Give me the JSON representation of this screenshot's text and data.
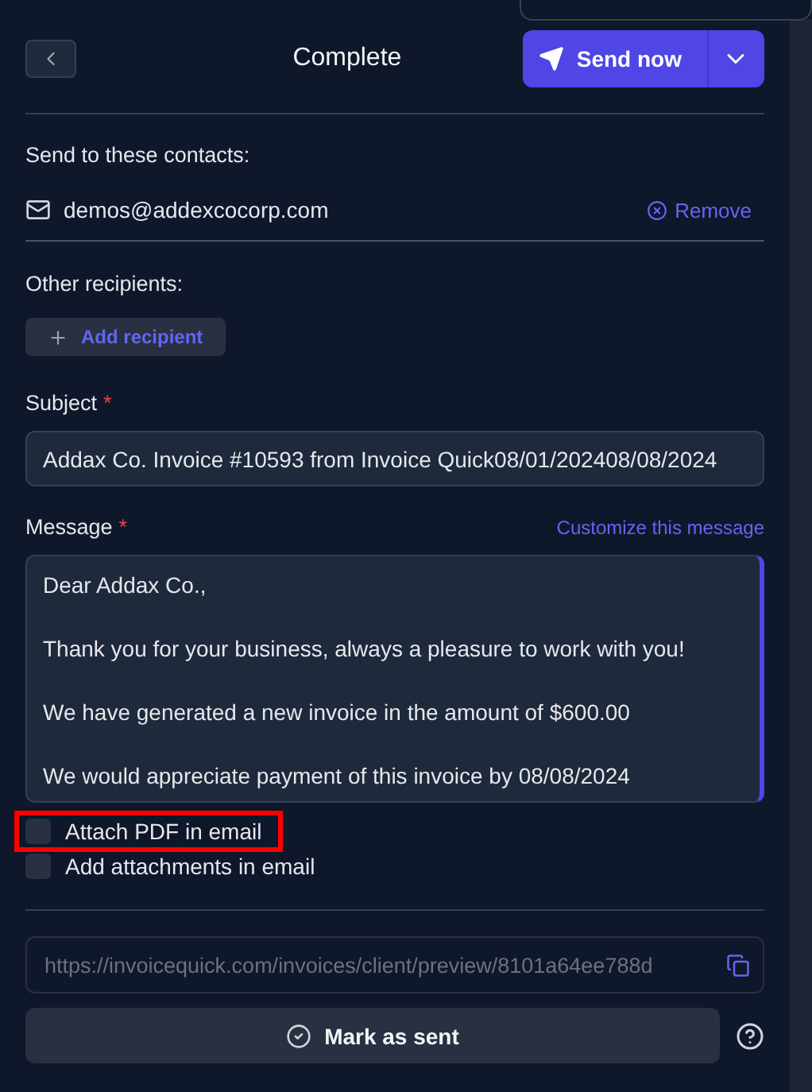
{
  "header": {
    "title": "Complete",
    "send_button": "Send now"
  },
  "contacts": {
    "label": "Send to these contacts:",
    "items": [
      {
        "email": "demos@addexcocorp.com",
        "action": "Remove"
      }
    ]
  },
  "other_recipients": {
    "label": "Other recipients:",
    "add_button": "Add recipient"
  },
  "subject": {
    "label": "Subject",
    "required_mark": "*",
    "value": "Addax Co. Invoice #10593 from Invoice Quick08/01/202408/08/2024"
  },
  "message": {
    "label": "Message",
    "required_mark": "*",
    "customize_link": "Customize this message",
    "paragraphs": [
      "Dear Addax Co.,",
      "Thank you for your business, always a pleasure to work with you!",
      "We have generated a new invoice in the amount of $600.00",
      "We would appreciate payment of this invoice by 08/08/2024"
    ]
  },
  "options": [
    {
      "label": "Attach PDF in email",
      "checked": false,
      "highlighted": true
    },
    {
      "label": "Add attachments in email",
      "checked": false,
      "highlighted": false
    }
  ],
  "link": {
    "value": "https://invoicequick.com/invoices/client/preview/8101a64ee788d"
  },
  "mark_sent_button": "Mark as sent"
}
